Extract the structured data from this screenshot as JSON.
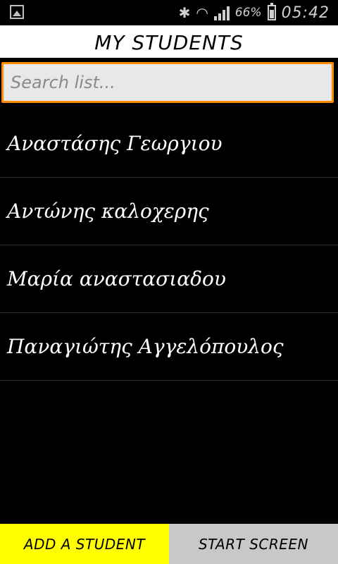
{
  "status_bar": {
    "battery_percent": "66%",
    "time": "05:42",
    "icons": [
      "image-icon",
      "bluetooth-icon",
      "wifi-icon",
      "signal-icon",
      "battery-icon"
    ],
    "battery_level": 0.66
  },
  "header": {
    "title": "MY STUDENTS"
  },
  "search": {
    "placeholder": "Search list..."
  },
  "students": [
    "Αναστάσης Γεωργιου",
    "Αντώνης καλοχερης",
    "Μαρία αναστασιαδου",
    "Παναγιώτης Αγγελόπουλος"
  ],
  "buttons": {
    "add_label": "ADD A STUDENT",
    "start_label": "START SCREEN"
  },
  "colors": {
    "accent_orange": "#ff8c00",
    "add_button": "#ffff00",
    "start_button": "#c8c8c8"
  }
}
